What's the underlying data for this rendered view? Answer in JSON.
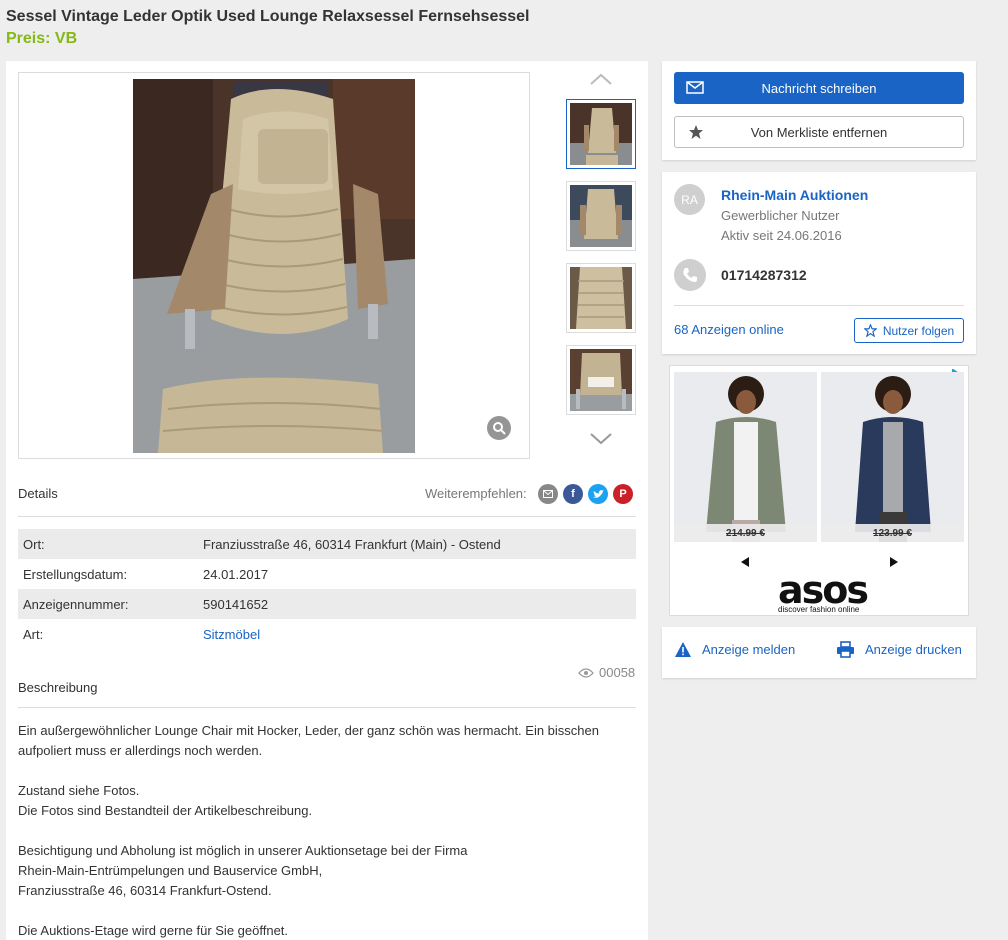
{
  "listing": {
    "title": "Sessel Vintage Leder Optik Used Lounge Relaxsessel Fernsehsessel",
    "price": "Preis: VB"
  },
  "gallery": {
    "thumbnails": [
      "thumb-1",
      "thumb-2",
      "thumb-3",
      "thumb-4"
    ]
  },
  "details": {
    "heading": "Details",
    "share_label": "Weiterempfehlen:",
    "share_icons": [
      "email-icon",
      "facebook-icon",
      "twitter-icon",
      "pinterest-icon"
    ],
    "rows": [
      {
        "key": "Ort:",
        "value": "Franziusstraße 46, 60314 Frankfurt (Main) - Ostend"
      },
      {
        "key": "Erstellungsdatum:",
        "value": "24.01.2017"
      },
      {
        "key": "Anzeigennummer:",
        "value": "590141652"
      },
      {
        "key": "Art:",
        "value": "Sitzmöbel"
      }
    ],
    "views": "00058"
  },
  "description": {
    "heading": "Beschreibung",
    "paragraphs": [
      [
        "Ein außergewöhnlicher Lounge Chair mit Hocker, Leder, der ganz schön was hermacht. Ein bisschen",
        "aufpoliert muss er allerdings noch werden."
      ],
      [
        "Zustand siehe Fotos.",
        "Die Fotos sind Bestandteil der Artikelbeschreibung."
      ],
      [
        "Besichtigung und Abholung ist möglich in unserer Auktionsetage bei der Firma",
        "Rhein-Main-Entrümpelungen und Bauservice GmbH,",
        "Franziusstraße 46, 60314 Frankfurt-Ostend."
      ],
      [
        "Die Auktions-Etage wird gerne für Sie geöffnet."
      ]
    ]
  },
  "actions": {
    "message_label": "Nachricht schreiben",
    "watchlist_label": "Von Merkliste entfernen"
  },
  "seller": {
    "initials": "RA",
    "name": "Rhein-Main Auktionen",
    "type": "Gewerblicher Nutzer",
    "active_since": "Aktiv seit 24.06.2016",
    "phone": "01714287312",
    "ads_online": "68 Anzeigen online",
    "follow_label": "Nutzer folgen"
  },
  "ad": {
    "brand": "asos",
    "tagline": "discover fashion online",
    "items": [
      {
        "price": "214.99 €",
        "jacket_color": "#7c8873"
      },
      {
        "price": "123.99 €",
        "jacket_color": "#2a3a5c"
      }
    ]
  },
  "footer_links": {
    "report": "Anzeige melden",
    "print": "Anzeige drucken"
  },
  "colors": {
    "accent": "#1964c4",
    "price_green": "#86b817"
  }
}
